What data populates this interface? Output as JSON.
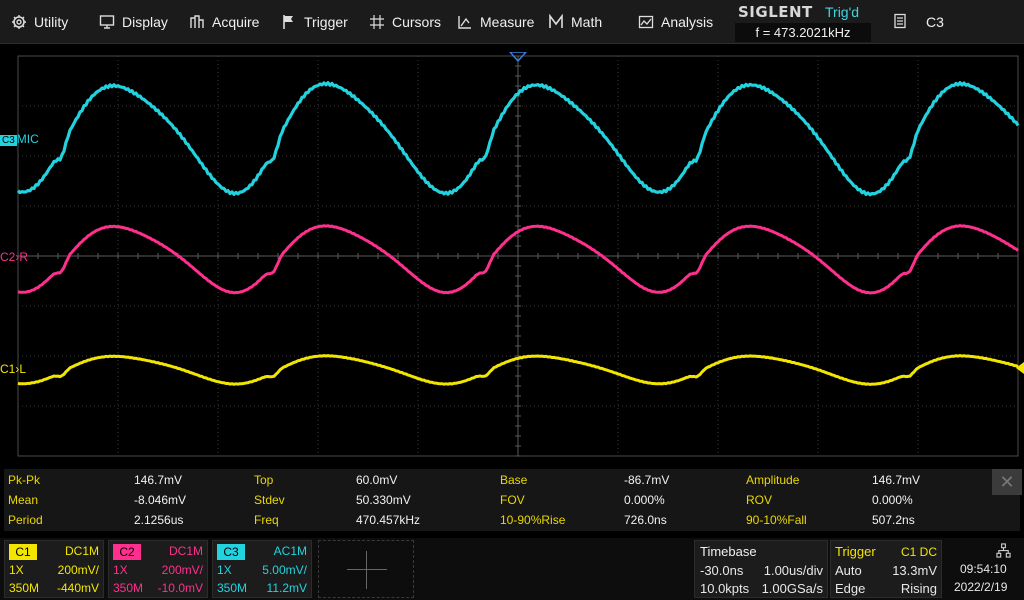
{
  "menu": [
    {
      "label": "Utility",
      "icon": "gear-icon"
    },
    {
      "label": "Display",
      "icon": "monitor-icon"
    },
    {
      "label": "Acquire",
      "icon": "acquire-icon"
    },
    {
      "label": "Trigger",
      "icon": "flag-icon"
    },
    {
      "label": "Cursors",
      "icon": "crosshair-icon"
    },
    {
      "label": "Measure",
      "icon": "measure-icon"
    },
    {
      "label": "Math",
      "icon": "math-icon"
    },
    {
      "label": "Analysis",
      "icon": "analysis-icon"
    }
  ],
  "brand": "SIGLENT",
  "trigger_status": "Trig'd",
  "frequency_readout": "f = 473.2021kHz",
  "channel_menu": {
    "label": "C3",
    "icon": "document-icon"
  },
  "channel_labels": {
    "c3": {
      "name": "C3",
      "tag": "MIC",
      "color": "#22d3df"
    },
    "c2": {
      "name": "C2",
      "tag": "R",
      "color": "#ff2f8e"
    },
    "c1": {
      "name": "C1",
      "tag": "L",
      "color": "#e6e000"
    }
  },
  "measurements": [
    [
      {
        "name": "Pk-Pk",
        "value": "146.7mV"
      },
      {
        "name": "Top",
        "value": "60.0mV"
      },
      {
        "name": "Base",
        "value": "-86.7mV"
      },
      {
        "name": "Amplitude",
        "value": "146.7mV"
      }
    ],
    [
      {
        "name": "Mean",
        "value": "-8.046mV"
      },
      {
        "name": "Stdev",
        "value": "50.330mV"
      },
      {
        "name": "FOV",
        "value": "0.000%"
      },
      {
        "name": "ROV",
        "value": "0.000%"
      }
    ],
    [
      {
        "name": "Period",
        "value": "2.1256us"
      },
      {
        "name": "Freq",
        "value": "470.457kHz"
      },
      {
        "name": "10-90%Rise",
        "value": "726.0ns"
      },
      {
        "name": "90-10%Fall",
        "value": "507.2ns"
      }
    ]
  ],
  "meas_close": "✕",
  "channels": [
    {
      "id": "C1",
      "coupling": "DC1M",
      "probe": "1X",
      "vdiv": "200mV/",
      "bw": "350M",
      "offset": "-440mV",
      "color": "#f2e600"
    },
    {
      "id": "C2",
      "coupling": "DC1M",
      "probe": "1X",
      "vdiv": "200mV/",
      "bw": "350M",
      "offset": "-10.0mV",
      "color": "#ff2f8e"
    },
    {
      "id": "C3",
      "coupling": "AC1M",
      "probe": "1X",
      "vdiv": "5.00mV/",
      "bw": "350M",
      "offset": "11.2mV",
      "color": "#22d3df"
    }
  ],
  "timebase": {
    "title": "Timebase",
    "delay": "-30.0ns",
    "tdiv": "1.00us/div",
    "points": "10.0kpts",
    "rate": "1.00GSa/s"
  },
  "trigger": {
    "title": "Trigger",
    "source": "C1 DC",
    "mode": "Auto",
    "level": "13.3mV",
    "type": "Edge",
    "slope": "Rising"
  },
  "clock": {
    "time": "09:54:10",
    "date": "2022/2/19"
  },
  "colors": {
    "grid": "#3a3a3a",
    "menu_bg": "#1b1b1b",
    "meas_name": "#e9d800"
  }
}
